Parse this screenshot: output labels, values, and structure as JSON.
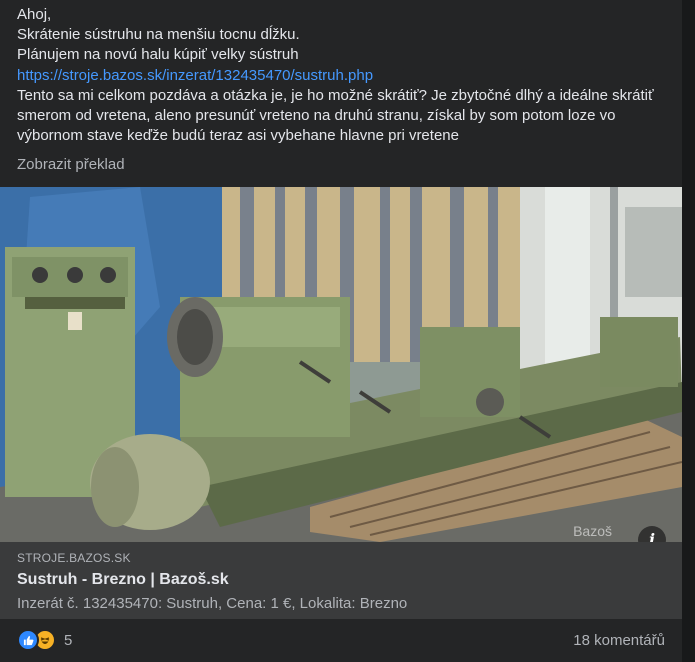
{
  "post": {
    "lines": [
      "Ahoj,",
      "Skrátenie sústruhu na menšiu tocnu dĺžku.",
      "Plánujem na novú halu kúpiť velky sústruh"
    ],
    "link_text": "https://stroje.bazos.sk/inzerat/132435470/sustruh.php",
    "body_lines": [
      "Tento sa mi celkom pozdáva a otázka je, je ho možné skrátiť? Je zbytočné dlhý a ideálne skrátiť",
      "smerom od vretena, aleno presunúť vreteno na druhú stranu, získal by som potom loze vo",
      "výbornom stave keďže budú teraz asi vybehane hlavne pri vretene"
    ],
    "translate_label": "Zobrazit překlad"
  },
  "photo": {
    "watermark": "Bazoš",
    "info_icon": "i"
  },
  "link_card": {
    "domain": "STROJE.BAZOS.SK",
    "title": "Sustruh - Brezno | Bazoš.sk",
    "description": "Inzerát č. 132435470: Sustruh, Cena: 1 €, Lokalita: Brezno"
  },
  "footer": {
    "reaction_icons": [
      "like-icon",
      "haha-icon"
    ],
    "reaction_count": "5",
    "comments_label": "18 komentářů"
  },
  "colors": {
    "post_bg": "#242526",
    "card_bg": "#3a3b3c",
    "link": "#4599ff",
    "secondary_text": "#b0b3b8"
  }
}
